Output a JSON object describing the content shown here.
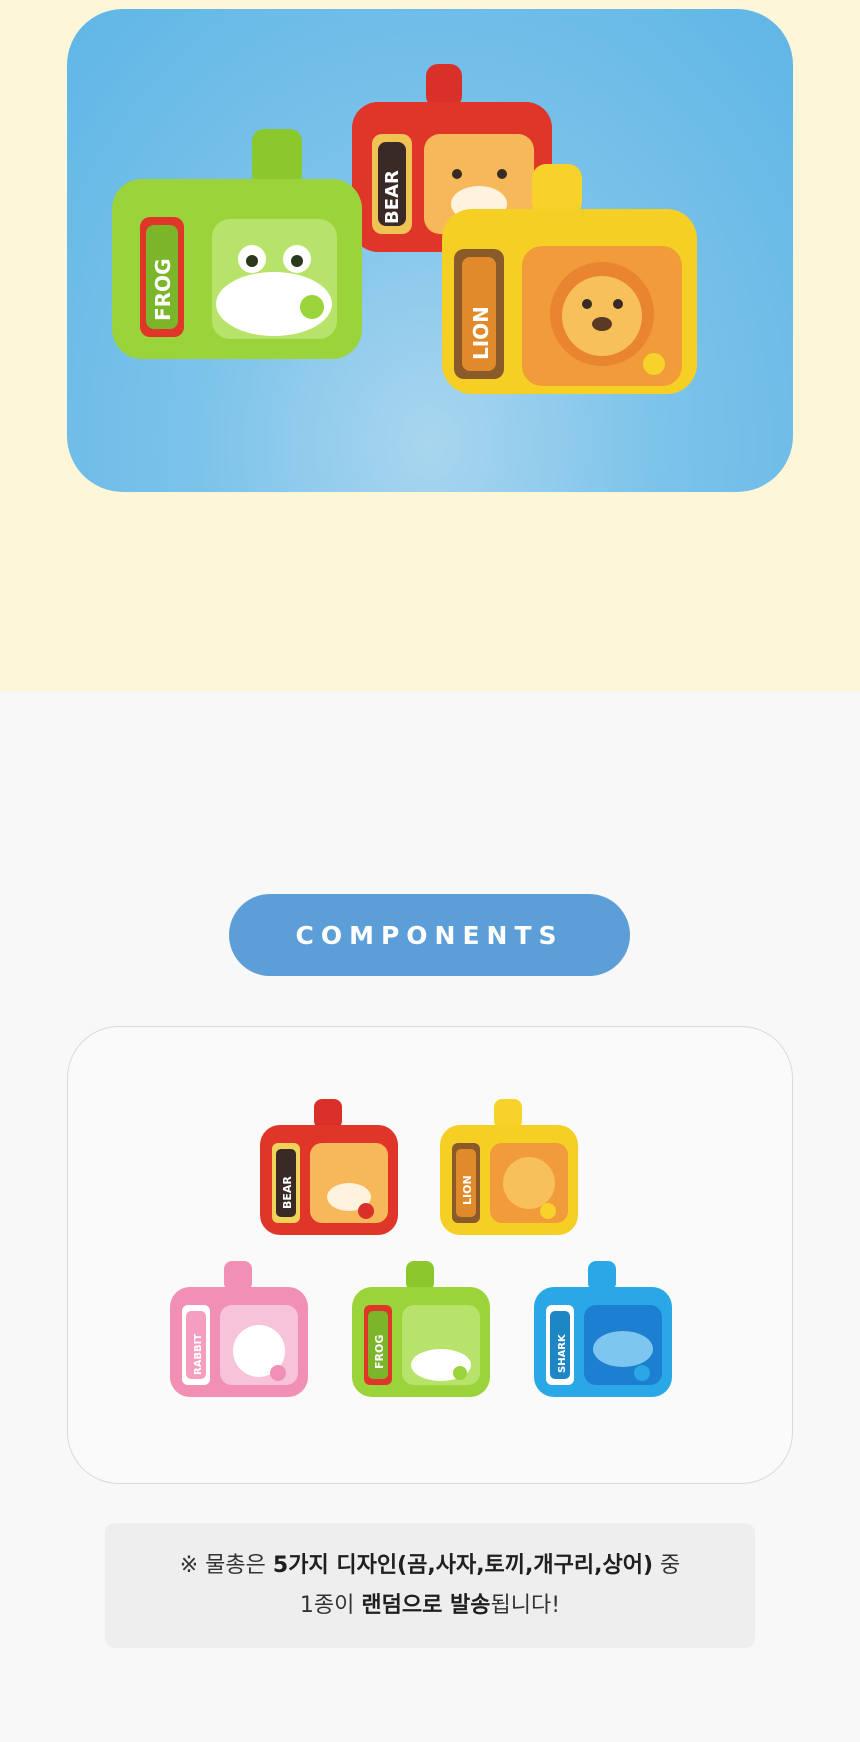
{
  "hero": {
    "cameras": [
      {
        "name": "FROG",
        "color": "#9ad43a"
      },
      {
        "name": "BEAR",
        "color": "#e0362a"
      },
      {
        "name": "LION",
        "color": "#f6cf25"
      }
    ]
  },
  "section_title": "COMPONENTS",
  "components": [
    {
      "name": "BEAR",
      "color": "#e0362a"
    },
    {
      "name": "LION",
      "color": "#f6cf25"
    },
    {
      "name": "RABBIT",
      "color": "#f28fb4"
    },
    {
      "name": "FROG",
      "color": "#9ad43a"
    },
    {
      "name": "SHARK",
      "color": "#2aa7e6"
    }
  ],
  "notice": {
    "line1_prefix": "※ 물총은 ",
    "line1_bold": "5가지 디자인(곰,사자,토끼,개구리,상어)",
    "line1_suffix": " 중",
    "line2_prefix": "1종이 ",
    "line2_bold": "랜덤으로 발송",
    "line2_suffix": "됩니다!"
  }
}
